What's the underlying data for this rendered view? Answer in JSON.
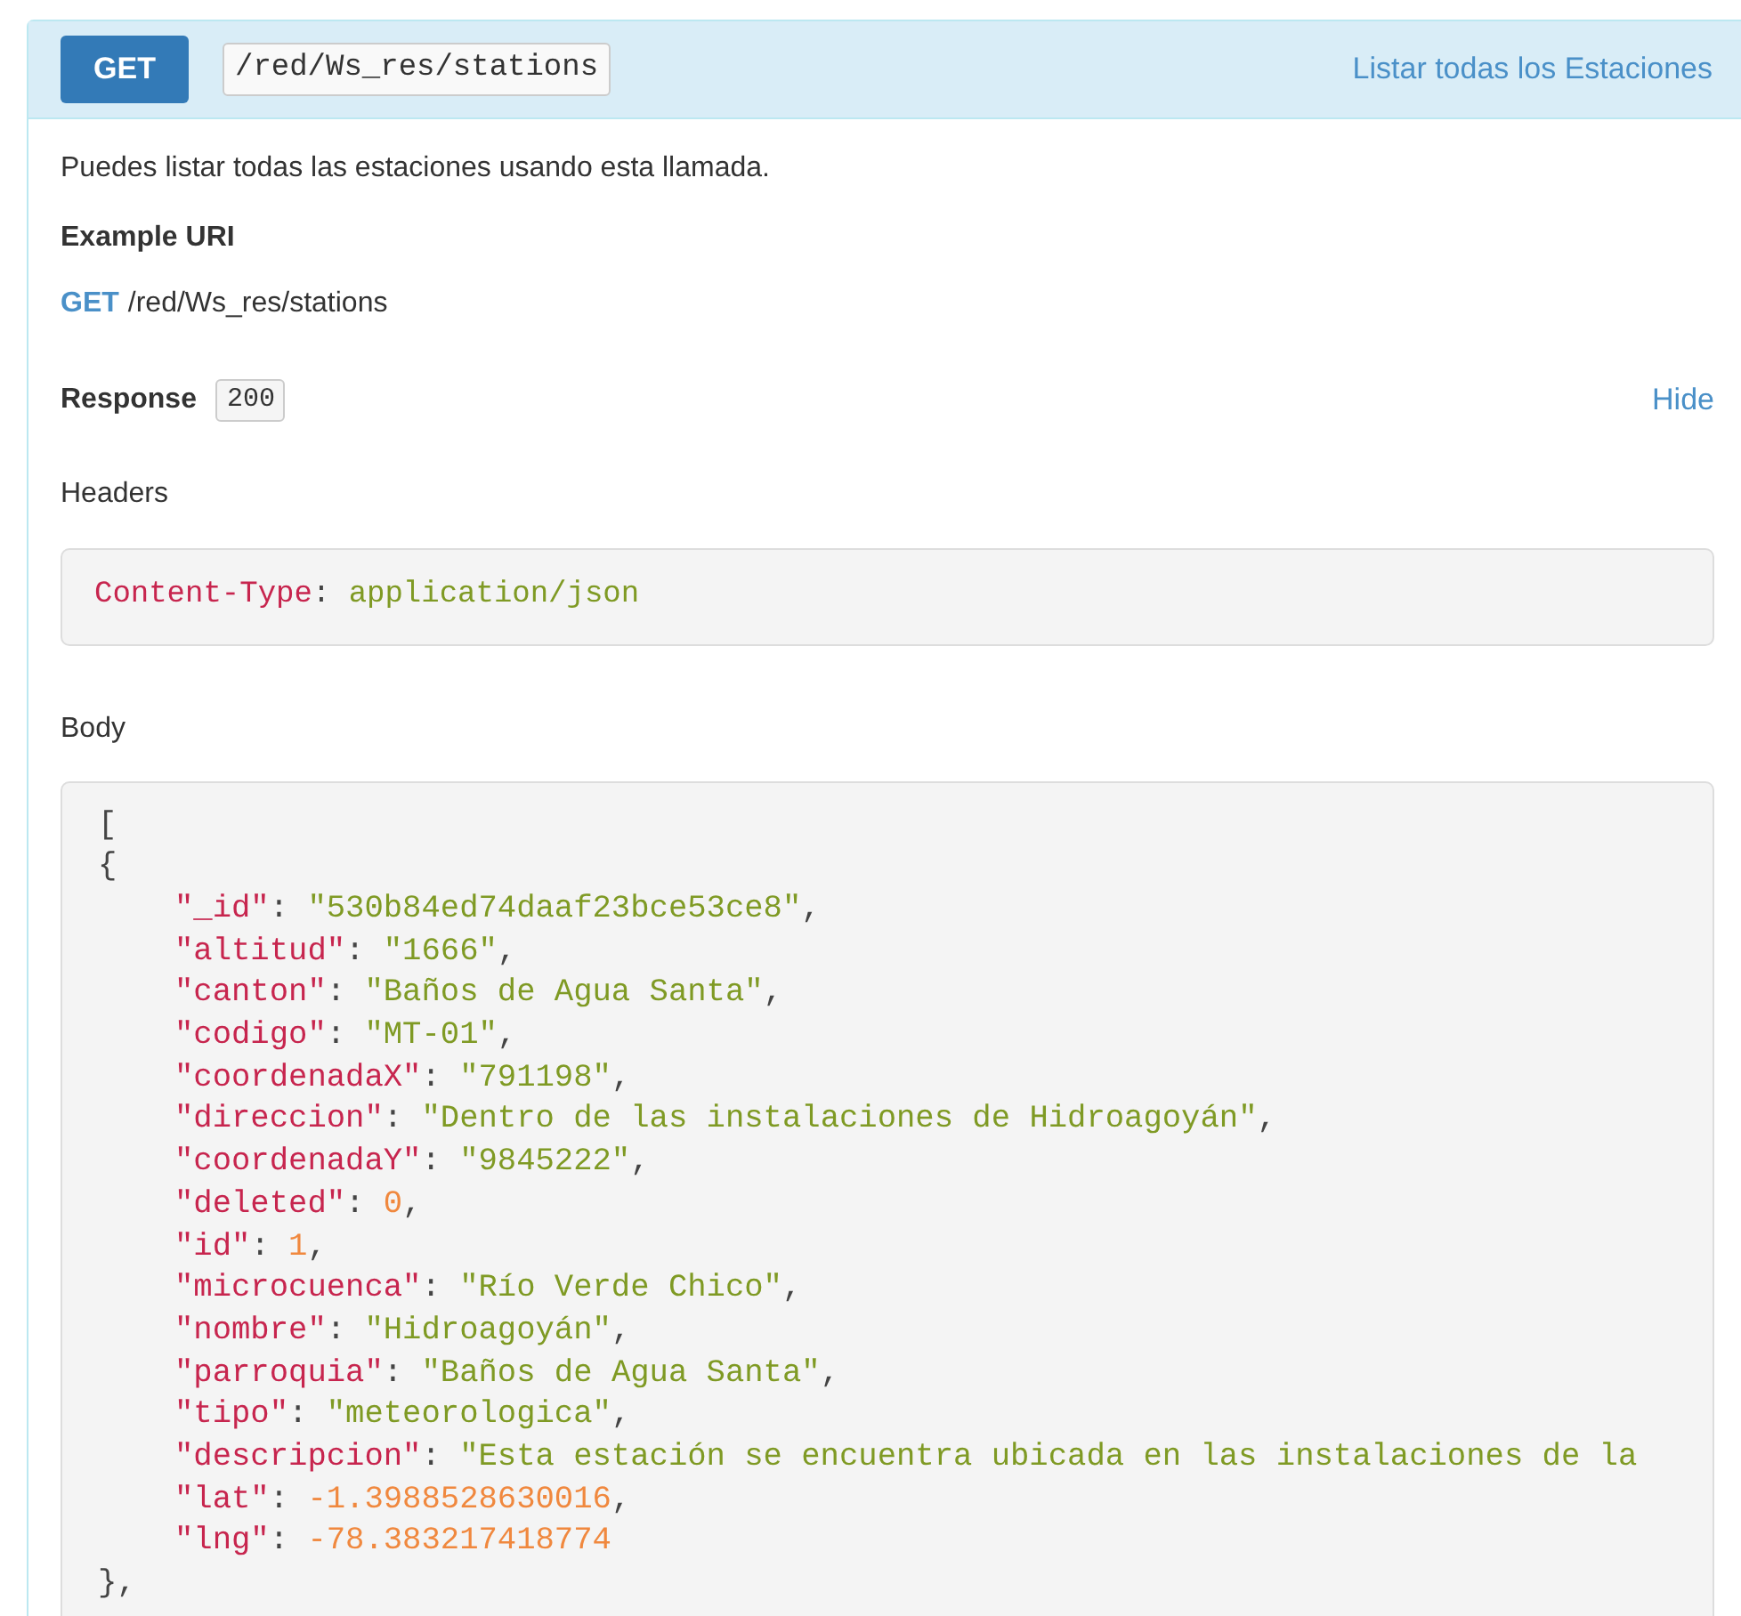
{
  "endpoint": {
    "method": "GET",
    "path": "/red/Ws_res/stations",
    "summary": "Listar todas los Estaciones"
  },
  "description": "Puedes listar todas las estaciones usando esta llamada.",
  "example_uri": {
    "heading": "Example URI",
    "method": "GET",
    "path": "/red/Ws_res/stations"
  },
  "response": {
    "label": "Response",
    "status": "200",
    "toggle": "Hide"
  },
  "headers": {
    "heading": "Headers",
    "tokens": [
      {
        "kind": "key",
        "text": "Content-Type"
      },
      {
        "kind": "punct",
        "text": ": "
      },
      {
        "kind": "string",
        "text": "application/json"
      }
    ]
  },
  "body": {
    "heading": "Body",
    "lines": [
      {
        "tokens": [
          {
            "kind": "punct",
            "text": "["
          }
        ]
      },
      {
        "tokens": [
          {
            "kind": "punct",
            "text": "{"
          }
        ],
        "children": [
          {
            "tokens": [
              {
                "kind": "key",
                "text": "\"_id\""
              },
              {
                "kind": "punct",
                "text": ": "
              },
              {
                "kind": "string",
                "text": "\"530b84ed74daaf23bce53ce8\""
              },
              {
                "kind": "punct",
                "text": ","
              }
            ]
          },
          {
            "tokens": [
              {
                "kind": "key",
                "text": "\"altitud\""
              },
              {
                "kind": "punct",
                "text": ": "
              },
              {
                "kind": "string",
                "text": "\"1666\""
              },
              {
                "kind": "punct",
                "text": ","
              }
            ]
          },
          {
            "tokens": [
              {
                "kind": "key",
                "text": "\"canton\""
              },
              {
                "kind": "punct",
                "text": ": "
              },
              {
                "kind": "string",
                "text": "\"Baños de Agua Santa\""
              },
              {
                "kind": "punct",
                "text": ","
              }
            ]
          },
          {
            "tokens": [
              {
                "kind": "key",
                "text": "\"codigo\""
              },
              {
                "kind": "punct",
                "text": ": "
              },
              {
                "kind": "string",
                "text": "\"MT-01\""
              },
              {
                "kind": "punct",
                "text": ","
              }
            ]
          },
          {
            "tokens": [
              {
                "kind": "key",
                "text": "\"coordenadaX\""
              },
              {
                "kind": "punct",
                "text": ": "
              },
              {
                "kind": "string",
                "text": "\"791198\""
              },
              {
                "kind": "punct",
                "text": ","
              }
            ]
          },
          {
            "tokens": [
              {
                "kind": "key",
                "text": "\"direccion\""
              },
              {
                "kind": "punct",
                "text": ": "
              },
              {
                "kind": "string",
                "text": "\"Dentro de las instalaciones de Hidroagoyán\""
              },
              {
                "kind": "punct",
                "text": ","
              }
            ]
          },
          {
            "tokens": [
              {
                "kind": "key",
                "text": "\"coordenadaY\""
              },
              {
                "kind": "punct",
                "text": ": "
              },
              {
                "kind": "string",
                "text": "\"9845222\""
              },
              {
                "kind": "punct",
                "text": ","
              }
            ]
          },
          {
            "tokens": [
              {
                "kind": "key",
                "text": "\"deleted\""
              },
              {
                "kind": "punct",
                "text": ": "
              },
              {
                "kind": "number",
                "text": "0"
              },
              {
                "kind": "punct",
                "text": ","
              }
            ]
          },
          {
            "tokens": [
              {
                "kind": "key",
                "text": "\"id\""
              },
              {
                "kind": "punct",
                "text": ": "
              },
              {
                "kind": "number",
                "text": "1"
              },
              {
                "kind": "punct",
                "text": ","
              }
            ]
          },
          {
            "tokens": [
              {
                "kind": "key",
                "text": "\"microcuenca\""
              },
              {
                "kind": "punct",
                "text": ": "
              },
              {
                "kind": "string",
                "text": "\"Río Verde Chico\""
              },
              {
                "kind": "punct",
                "text": ","
              }
            ]
          },
          {
            "tokens": [
              {
                "kind": "key",
                "text": "\"nombre\""
              },
              {
                "kind": "punct",
                "text": ": "
              },
              {
                "kind": "string",
                "text": "\"Hidroagoyán\""
              },
              {
                "kind": "punct",
                "text": ","
              }
            ]
          },
          {
            "tokens": [
              {
                "kind": "key",
                "text": "\"parroquia\""
              },
              {
                "kind": "punct",
                "text": ": "
              },
              {
                "kind": "string",
                "text": "\"Baños de Agua Santa\""
              },
              {
                "kind": "punct",
                "text": ","
              }
            ]
          },
          {
            "tokens": [
              {
                "kind": "key",
                "text": "\"tipo\""
              },
              {
                "kind": "punct",
                "text": ": "
              },
              {
                "kind": "string",
                "text": "\"meteorologica\""
              },
              {
                "kind": "punct",
                "text": ","
              }
            ]
          },
          {
            "tokens": [
              {
                "kind": "key",
                "text": "\"descripcion\""
              },
              {
                "kind": "punct",
                "text": ": "
              },
              {
                "kind": "string",
                "text": "\"Esta estación se encuentra ubicada en las instalaciones de la"
              }
            ]
          },
          {
            "tokens": [
              {
                "kind": "key",
                "text": "\"lat\""
              },
              {
                "kind": "punct",
                "text": ": "
              },
              {
                "kind": "number",
                "text": "-1.3988528630016"
              },
              {
                "kind": "punct",
                "text": ","
              }
            ]
          },
          {
            "tokens": [
              {
                "kind": "key",
                "text": "\"lng\""
              },
              {
                "kind": "punct",
                "text": ": "
              },
              {
                "kind": "number",
                "text": "-78.383217418774"
              }
            ]
          }
        ]
      },
      {
        "tokens": [
          {
            "kind": "punct",
            "text": "},"
          }
        ]
      }
    ]
  }
}
